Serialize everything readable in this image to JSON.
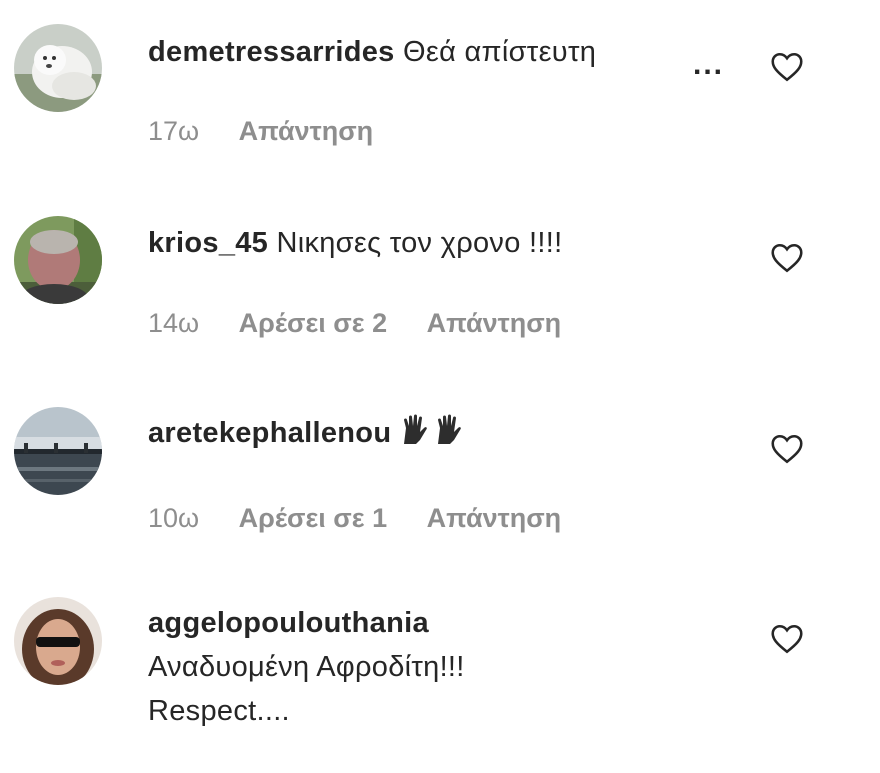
{
  "comments": [
    {
      "username": "demetressarrides",
      "text": "Θεά απίστευτη",
      "more": "...",
      "time": "17ω",
      "likes": "",
      "reply": "Απάντηση",
      "avatar": "white-dog-avatar"
    },
    {
      "username": "krios_45",
      "text": "Νικησες τον χρονο !!!!",
      "time": "14ω",
      "likes": "Αρέσει σε 2",
      "reply": "Απάντηση",
      "avatar": "man-outdoors-avatar"
    },
    {
      "username": "aretekephallenou",
      "emoji": "raised-hands-emoji",
      "time": "10ω",
      "likes": "Αρέσει σε 1",
      "reply": "Απάντηση",
      "avatar": "bridge-landscape-avatar"
    },
    {
      "username": "aggelopoulouthania",
      "text_line1": "Αναδυομένη Αφροδίτη!!!",
      "text_line2": "Respect....",
      "avatar": "woman-sunglasses-avatar"
    }
  ],
  "icons": {
    "like": "heart-outline-icon"
  },
  "colors": {
    "text": "#262626",
    "meta": "#8e8e8e",
    "background": "#ffffff"
  }
}
